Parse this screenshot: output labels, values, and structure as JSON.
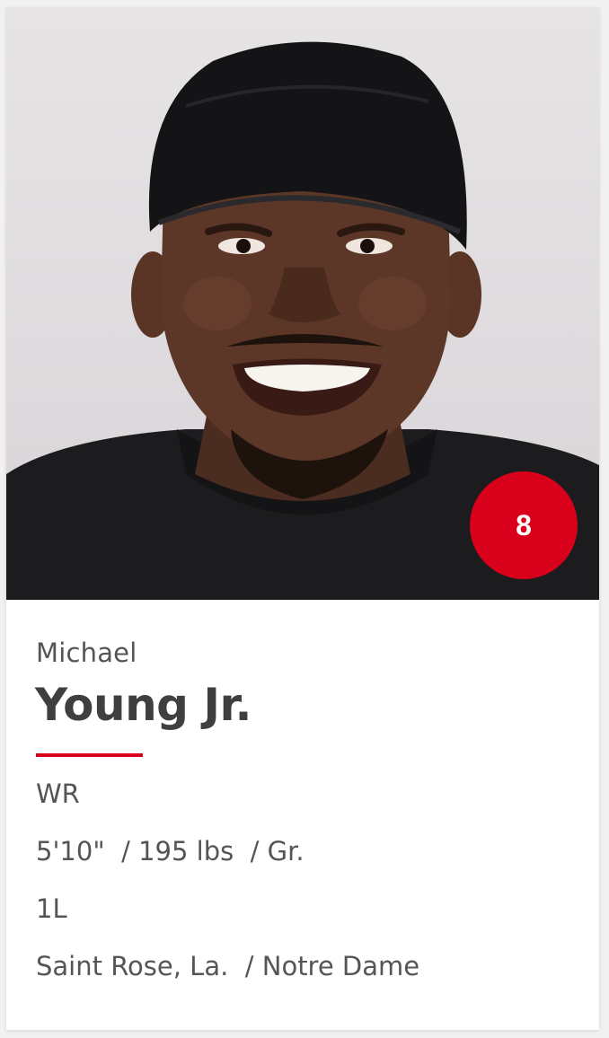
{
  "colors": {
    "accent": "#d9001b",
    "badge": "#d9001b",
    "text": "#555555",
    "name": "#3f3f3f"
  },
  "player": {
    "number": "8",
    "first_name": "Michael",
    "last_name": "Young Jr.",
    "position": "WR",
    "measurables": "5'10\"  / 195 lbs  / Gr.",
    "experience": "1L",
    "hometown": "Saint Rose, La.  / Notre Dame",
    "photo_icon": "player-headshot"
  }
}
